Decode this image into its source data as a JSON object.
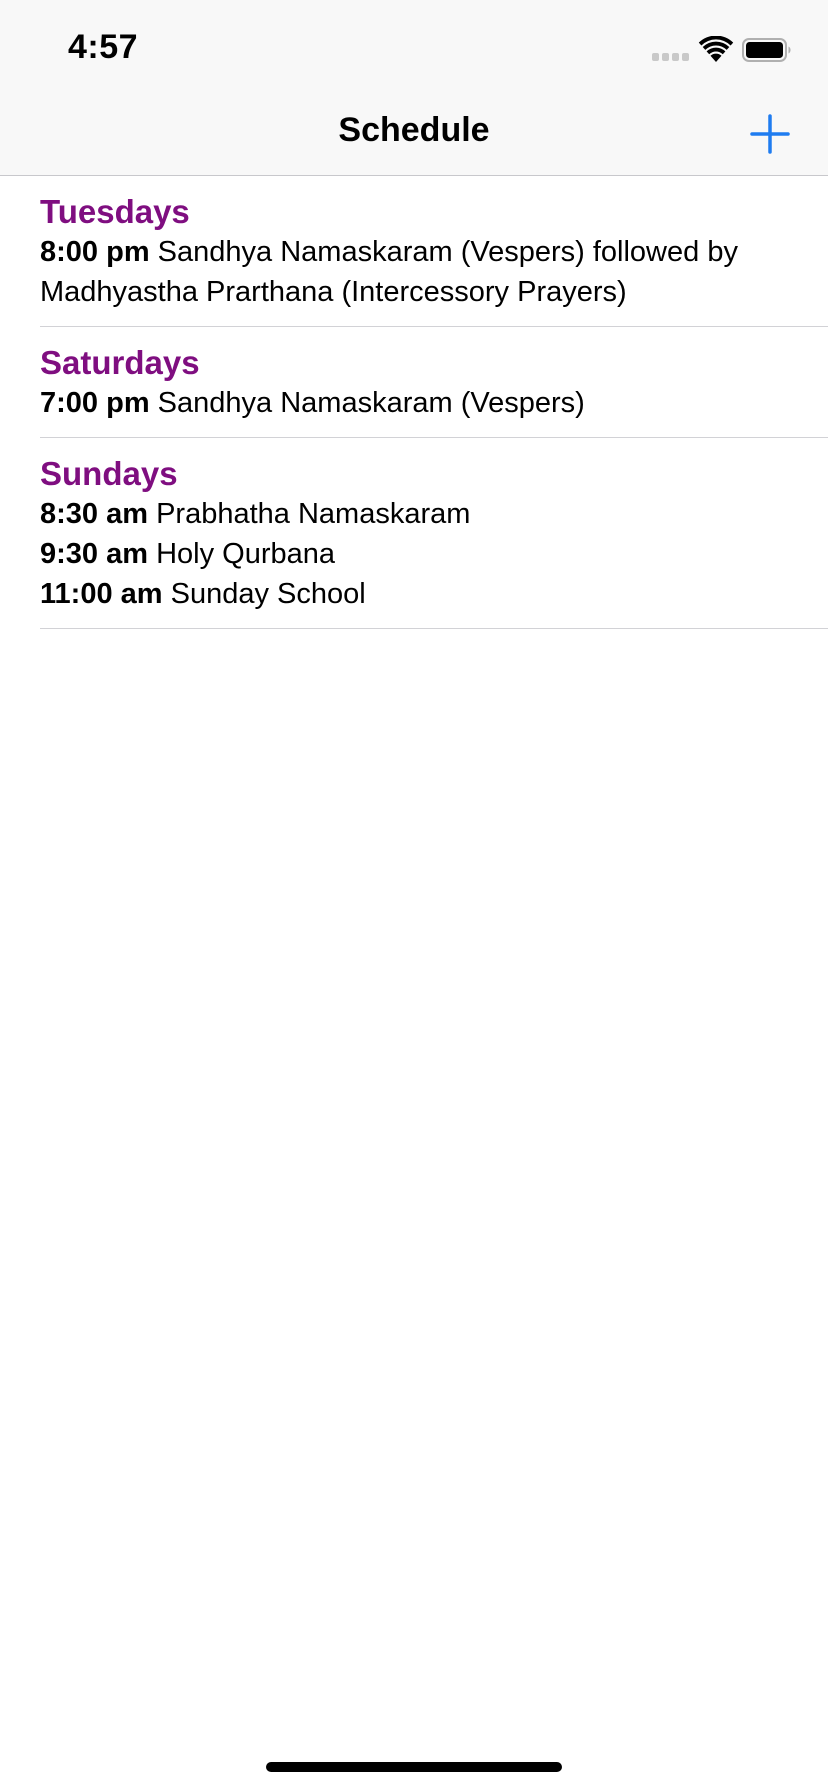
{
  "status_bar": {
    "time": "4:57"
  },
  "nav": {
    "title": "Schedule",
    "add_icon": "plus-icon"
  },
  "colors": {
    "day_heading": "#7f0e80",
    "accent": "#1f7cf0",
    "nav_background": "#f8f8f8",
    "separator": "#d2d2d6"
  },
  "schedule": [
    {
      "day": "Tuesdays",
      "entries": [
        {
          "time": "8:00 pm",
          "text": "Sandhya Namaskaram (Vespers) followed by Madhyastha Prarthana (Intercessory Prayers)"
        }
      ]
    },
    {
      "day": "Saturdays",
      "entries": [
        {
          "time": "7:00 pm",
          "text": "Sandhya Namaskaram (Vespers)"
        }
      ]
    },
    {
      "day": "Sundays",
      "entries": [
        {
          "time": "8:30 am",
          "text": "Prabhatha Namaskaram"
        },
        {
          "time": "9:30 am",
          "text": "Holy Qurbana"
        },
        {
          "time": "11:00 am",
          "text": "Sunday School"
        }
      ]
    }
  ]
}
